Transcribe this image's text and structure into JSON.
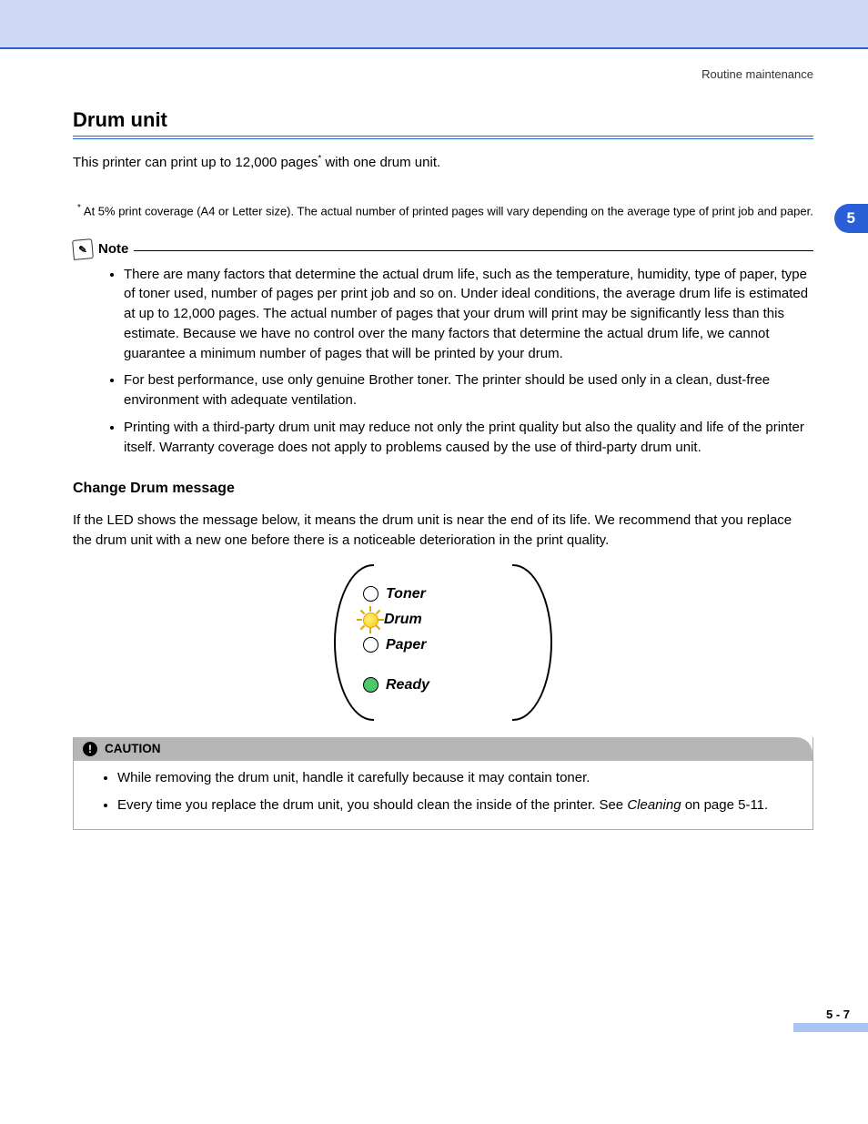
{
  "header": {
    "running_head": "Routine maintenance",
    "chapter_tab": "5"
  },
  "title": "Drum unit",
  "intro_before": "This printer can print up to 12,000 pages",
  "intro_after": " with one drum unit.",
  "footnote": "At 5% print coverage (A4 or Letter size). The actual number of printed pages will vary depending on the average type of print job and paper.",
  "note": {
    "label": "Note",
    "items": [
      "There are many factors that determine the actual drum life, such as the temperature, humidity, type of paper, type of toner used, number of pages per print job and so on. Under ideal conditions, the average drum life is estimated at up to 12,000 pages. The actual number of pages that your drum will print may be significantly less than this estimate. Because we have no control over the many factors that determine the actual drum life, we cannot guarantee a minimum number of pages that will be printed by your drum.",
      "For best performance, use only genuine Brother toner. The printer should be used only in a clean, dust-free environment with adequate ventilation.",
      "Printing with a third-party drum unit may reduce not only the print quality but also the quality and life of the printer itself. Warranty coverage does not apply to problems caused by the use of third-party drum unit."
    ]
  },
  "subsection": {
    "title": "Change Drum message",
    "text": "If the LED shows the message below, it means the drum unit is near the end of its life. We recommend that you replace the drum unit with a new one before there is a noticeable deterioration in the print quality."
  },
  "led_panel": {
    "toner": "Toner",
    "drum": "Drum",
    "paper": "Paper",
    "ready": "Ready"
  },
  "caution": {
    "label": "CAUTION",
    "items": [
      "While removing the drum unit, handle it carefully because it may contain toner.",
      "Every time you replace the drum unit, you should clean the inside of the printer. See "
    ],
    "link_text": "Cleaning",
    "link_suffix": " on page 5-11."
  },
  "page_number": "5 - 7"
}
